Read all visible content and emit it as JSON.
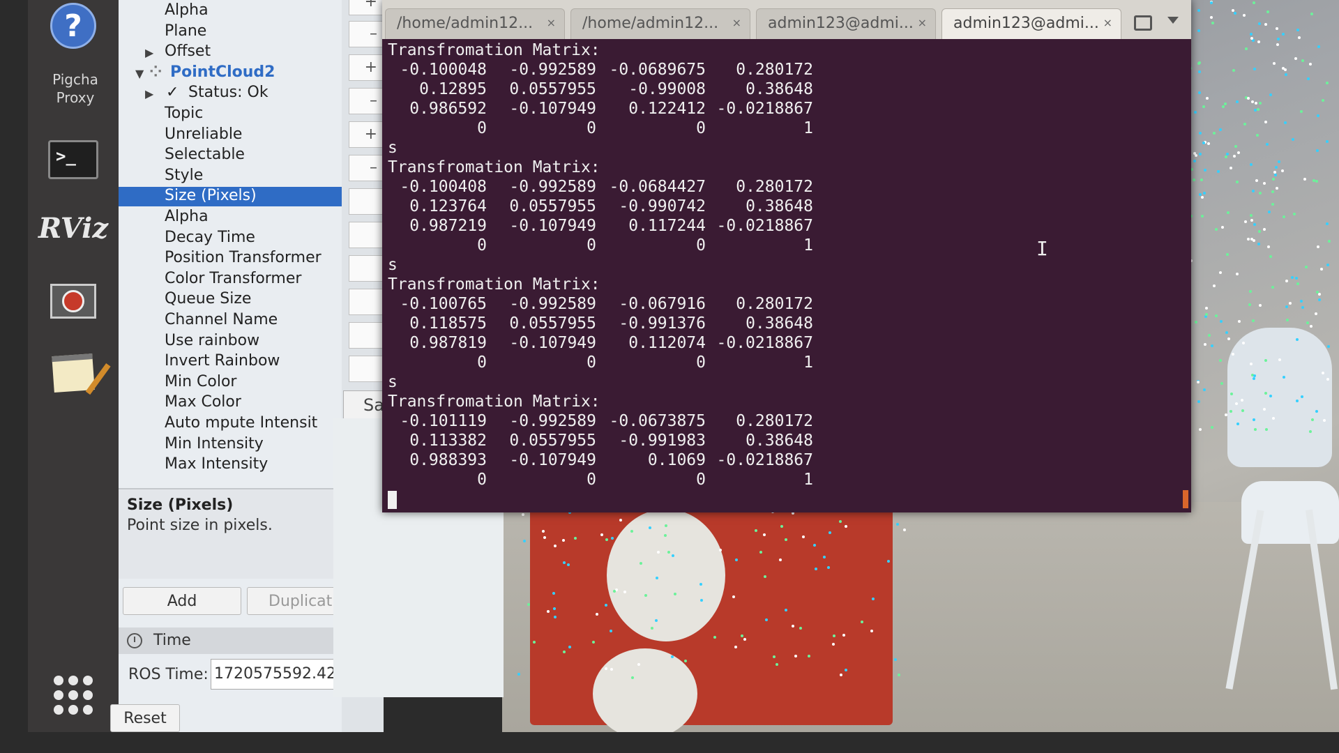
{
  "launcher": {
    "pigcha_label": "Pigcha\nProxy",
    "rviz_label": "RViz",
    "icons": [
      "help-icon",
      "terminal-icon",
      "rviz-icon",
      "stop-icon",
      "notes-icon",
      "apps-grid-icon"
    ]
  },
  "displays": {
    "rows": [
      {
        "label": "Alpha",
        "indent": 1
      },
      {
        "label": "Plane",
        "indent": 1
      },
      {
        "label": "Offset",
        "indent": 1,
        "arrow": "collapsed"
      },
      {
        "label": "PointCloud2",
        "indent": 0,
        "arrow": "expanded"
      },
      {
        "label": "Status: Ok",
        "indent": 1,
        "arrow": "collapsed"
      },
      {
        "label": "Topic",
        "indent": 1
      },
      {
        "label": "Unreliable",
        "indent": 1
      },
      {
        "label": "Selectable",
        "indent": 1
      },
      {
        "label": "Style",
        "indent": 1
      },
      {
        "label": "Size (Pixels)",
        "indent": 1,
        "selected": true
      },
      {
        "label": "Alpha",
        "indent": 1
      },
      {
        "label": "Decay Time",
        "indent": 1
      },
      {
        "label": "Position Transformer",
        "indent": 1
      },
      {
        "label": "Color Transformer",
        "indent": 1
      },
      {
        "label": "Queue Size",
        "indent": 1
      },
      {
        "label": "Channel Name",
        "indent": 1
      },
      {
        "label": "Use rainbow",
        "indent": 1
      },
      {
        "label": "Invert Rainbow",
        "indent": 1
      },
      {
        "label": "Min Color",
        "indent": 1
      },
      {
        "label": "Max Color",
        "indent": 1
      },
      {
        "label": "Auto mpute Intensit",
        "indent": 1
      },
      {
        "label": "Min Intensity",
        "indent": 1
      },
      {
        "label": "Max Intensity",
        "indent": 1
      }
    ],
    "check_mark": "✓",
    "description_title": "Size (Pixels)",
    "description_text": "Point size in pixels.",
    "add_label": "Add",
    "duplicate_label": "Duplicat",
    "time_header": "Time",
    "ros_time_label": "ROS Time:",
    "ros_time_value": "1720575592.42",
    "reset_label": "Reset"
  },
  "value_column": {
    "cells": [
      "+",
      "–",
      "+",
      "–",
      "+",
      "–"
    ],
    "partial_label": "Sa"
  },
  "terminal": {
    "tabs": [
      {
        "title": "/home/admin12...",
        "close": "×"
      },
      {
        "title": "/home/admin12...",
        "close": "×"
      },
      {
        "title": "admin123@admi...",
        "close": "×"
      },
      {
        "title": "admin123@admi...",
        "close": "×",
        "active": true
      }
    ],
    "blocks": [
      {
        "prefix": "",
        "header": "Transfromation Matrix:",
        "rows": [
          [
            "-0.100048",
            "-0.992589",
            "-0.0689675",
            "0.280172"
          ],
          [
            "0.12895",
            "0.0557955",
            "-0.99008",
            "0.38648"
          ],
          [
            "0.986592",
            "-0.107949",
            "0.122412",
            "-0.0218867"
          ],
          [
            "0",
            "0",
            "0",
            "1"
          ]
        ]
      },
      {
        "prefix": "s",
        "header": "Transfromation Matrix:",
        "rows": [
          [
            "-0.100408",
            "-0.992589",
            "-0.0684427",
            "0.280172"
          ],
          [
            "0.123764",
            "0.0557955",
            "-0.990742",
            "0.38648"
          ],
          [
            "0.987219",
            "-0.107949",
            "0.117244",
            "-0.0218867"
          ],
          [
            "0",
            "0",
            "0",
            "1"
          ]
        ]
      },
      {
        "prefix": "s",
        "header": "Transfromation Matrix:",
        "rows": [
          [
            "-0.100765",
            "-0.992589",
            "-0.067916",
            "0.280172"
          ],
          [
            "0.118575",
            "0.0557955",
            "-0.991376",
            "0.38648"
          ],
          [
            "0.987819",
            "-0.107949",
            "0.112074",
            "-0.0218867"
          ],
          [
            "0",
            "0",
            "0",
            "1"
          ]
        ]
      },
      {
        "prefix": "s",
        "header": "Transfromation Matrix:",
        "rows": [
          [
            "-0.101119",
            "-0.992589",
            "-0.0673875",
            "0.280172"
          ],
          [
            "0.113382",
            "0.0557955",
            "-0.991983",
            "0.38648"
          ],
          [
            "0.988393",
            "-0.107949",
            "0.1069",
            "-0.0218867"
          ],
          [
            "0",
            "0",
            "0",
            "1"
          ]
        ]
      }
    ],
    "colors": {
      "background": "#3a1b33",
      "text": "#f0f0f0",
      "scroll_marker": "#d9662b"
    }
  },
  "colors": {
    "selection": "#2f6cc5",
    "panel": "#e9edf1",
    "cloud_dots": [
      "#35d0ff",
      "#6cf29a",
      "#ffffff"
    ]
  }
}
